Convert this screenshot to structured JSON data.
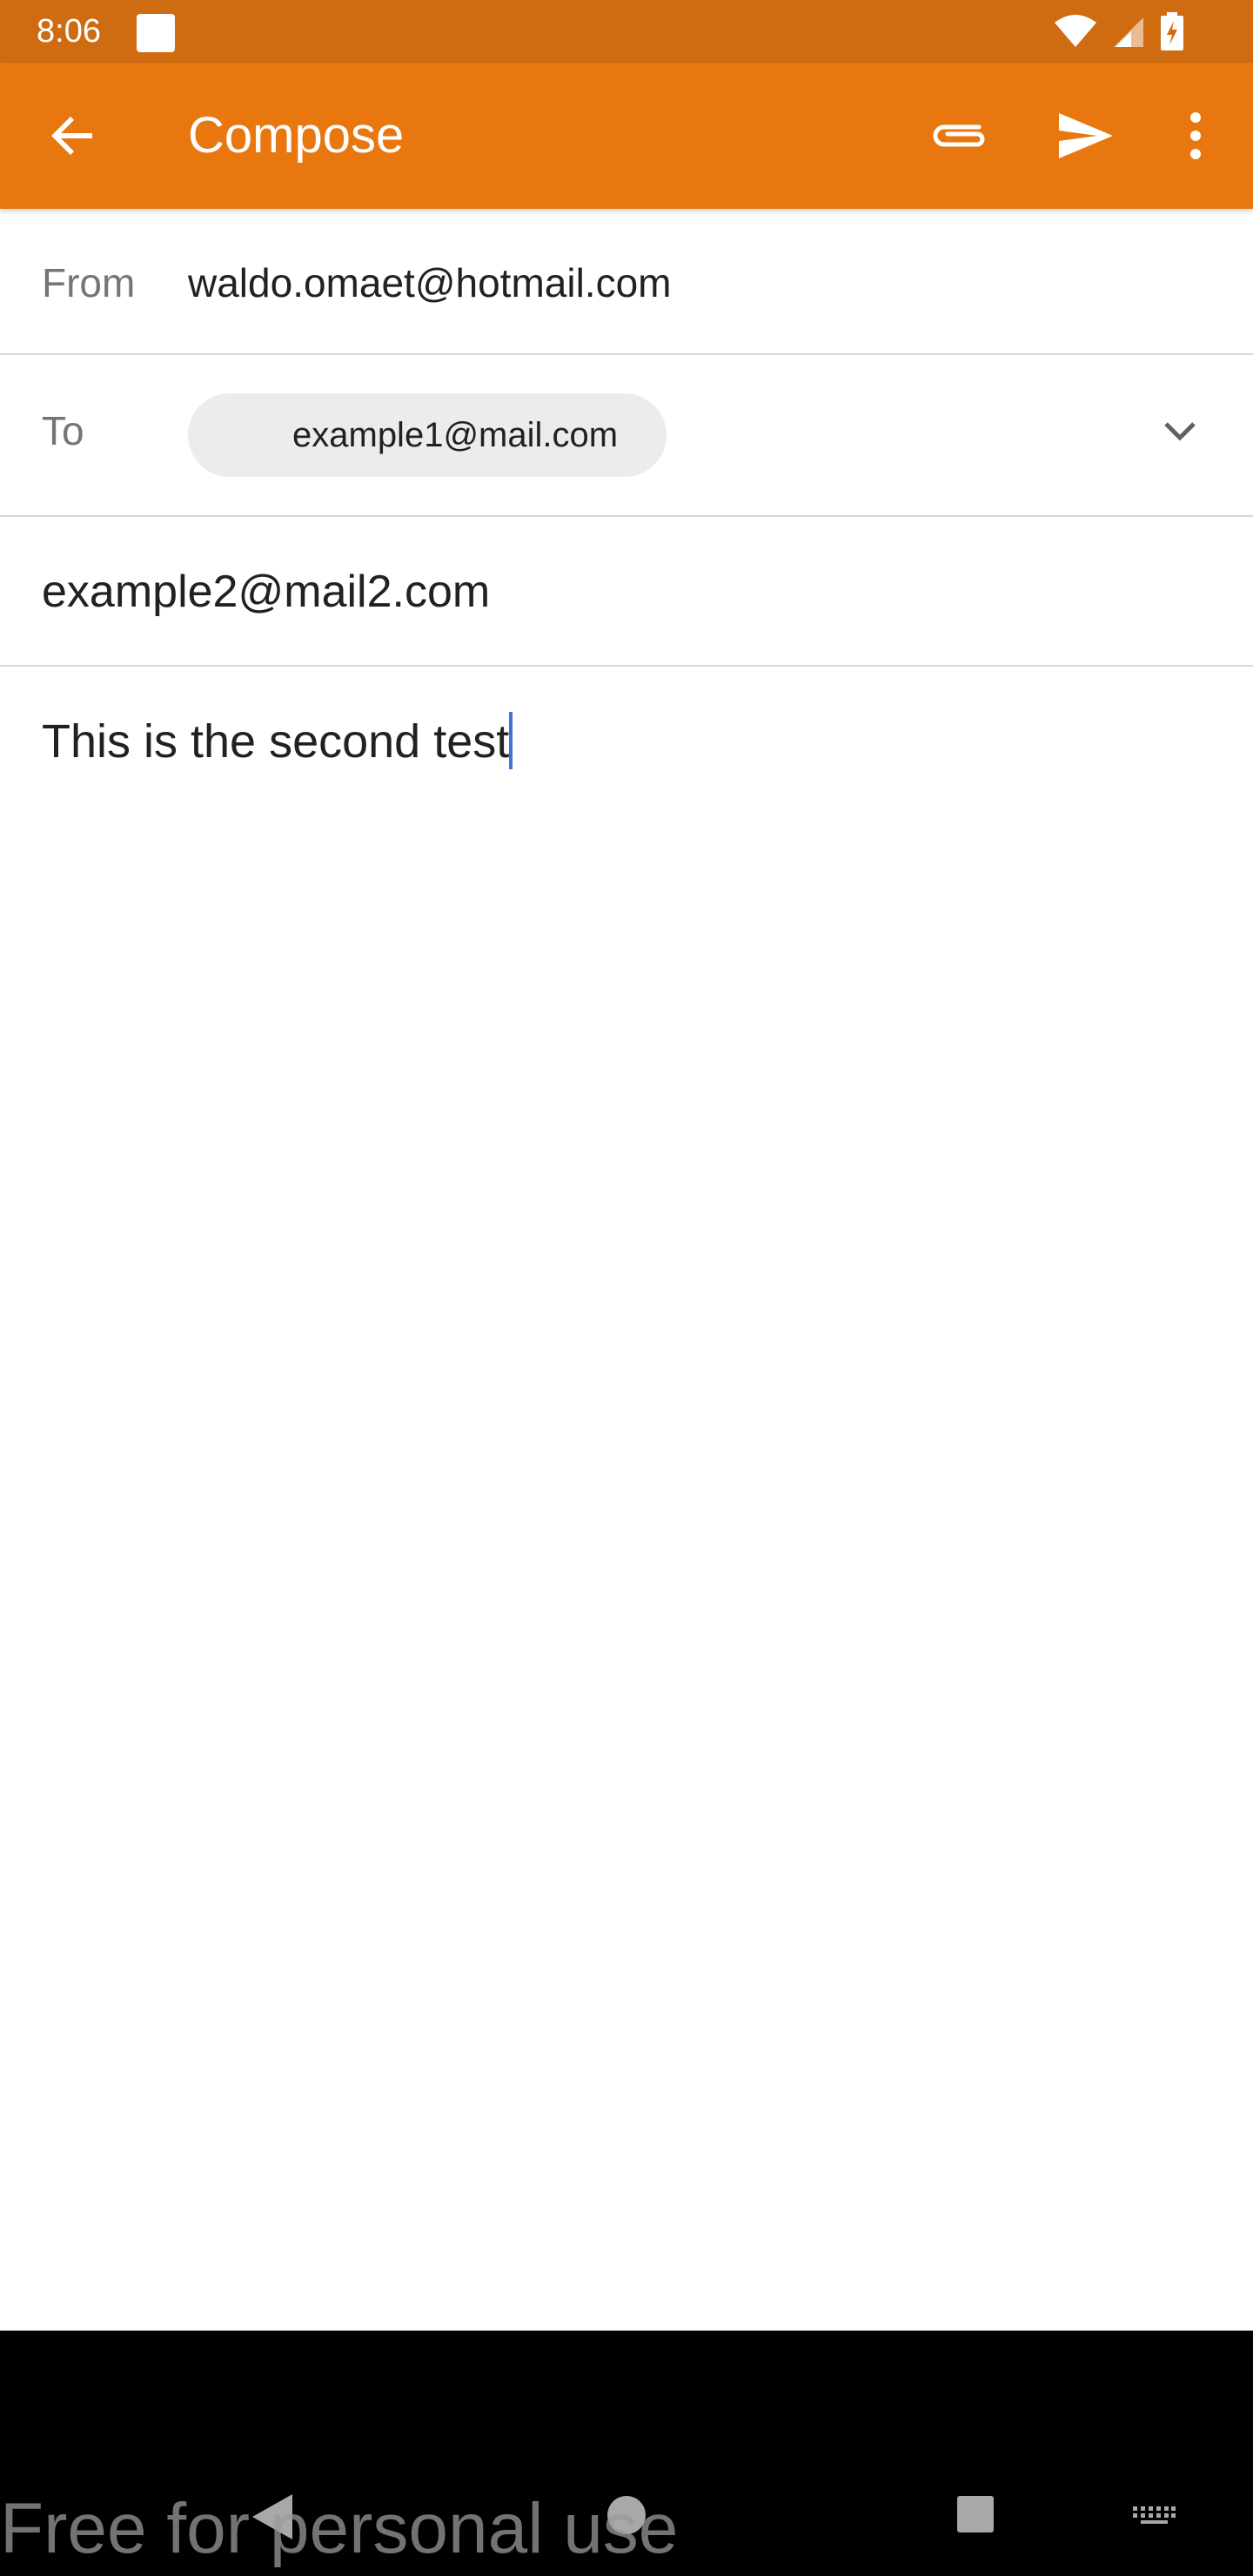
{
  "status_bar": {
    "time": "8:06",
    "icons": [
      "wifi-icon",
      "cell-signal-icon",
      "battery-charging-icon"
    ]
  },
  "app_bar": {
    "title": "Compose",
    "background": "#e8770f",
    "actions": [
      "back-arrow-icon",
      "attach-icon",
      "send-icon",
      "more-vert-icon"
    ]
  },
  "compose": {
    "from_label": "From",
    "from_value": "waldo.omaet@hotmail.com",
    "to_label": "To",
    "to_chip": "example1@mail.com",
    "subject_value": "example2@mail2.com",
    "body_value": "This is the second test"
  },
  "nav_bar": {
    "buttons": [
      "back-icon",
      "home-icon",
      "recents-icon",
      "keyboard-icon"
    ]
  },
  "watermark": "Free for personal use"
}
